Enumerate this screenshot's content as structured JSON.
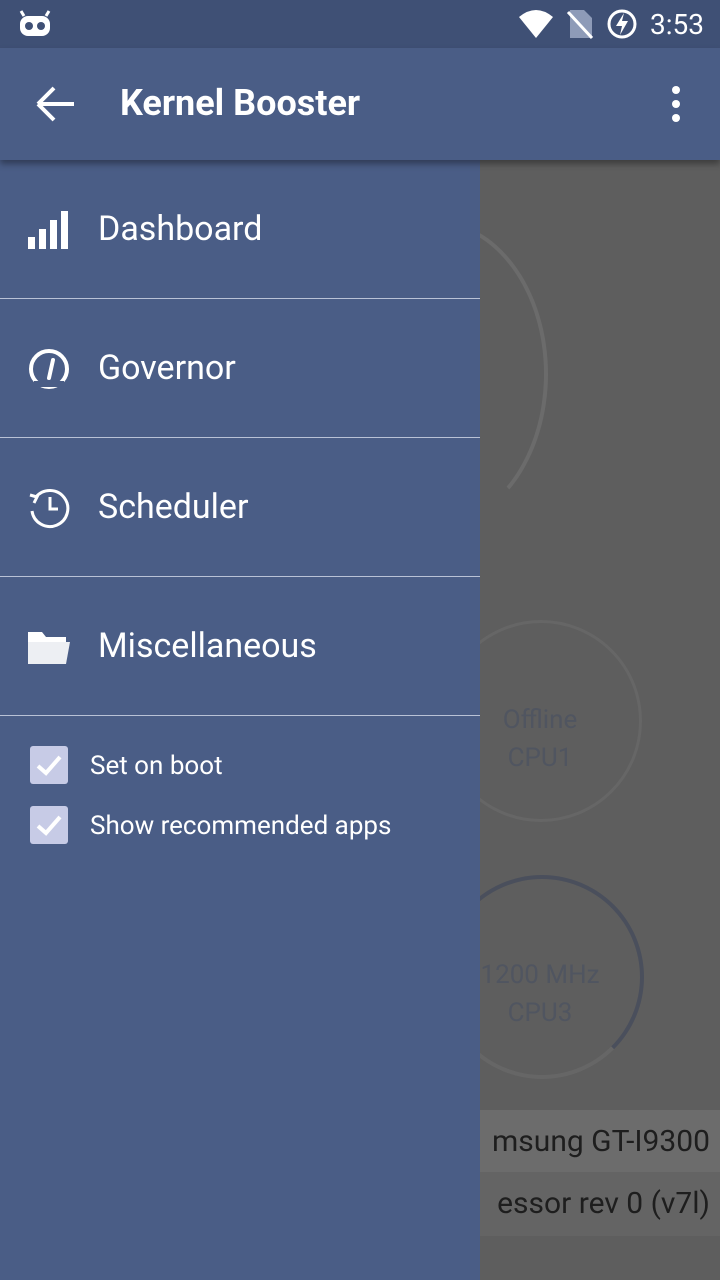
{
  "status_bar": {
    "time": "3:53"
  },
  "app_bar": {
    "title": "Kernel Booster"
  },
  "drawer": {
    "nav_items": [
      {
        "label": "Dashboard",
        "icon": "signal-bars-icon"
      },
      {
        "label": "Governor",
        "icon": "gauge-icon"
      },
      {
        "label": "Scheduler",
        "icon": "clock-history-icon"
      },
      {
        "label": "Miscellaneous",
        "icon": "folder-icon"
      }
    ],
    "options": [
      {
        "label": "Set on boot",
        "checked": true
      },
      {
        "label": "Show recommended apps",
        "checked": true
      }
    ]
  },
  "background": {
    "cpu1": {
      "status": "Offline",
      "label": "CPU1"
    },
    "cpu3": {
      "freq": "1200 MHz",
      "label": "CPU3"
    },
    "device": "msung GT-I9300",
    "processor": "essor rev 0 (v7l)"
  },
  "colors": {
    "primary": "#4a5d86",
    "status_bar": "#3f5075",
    "scrim": "#5e5e5e",
    "checkbox": "#c7cbe6"
  }
}
